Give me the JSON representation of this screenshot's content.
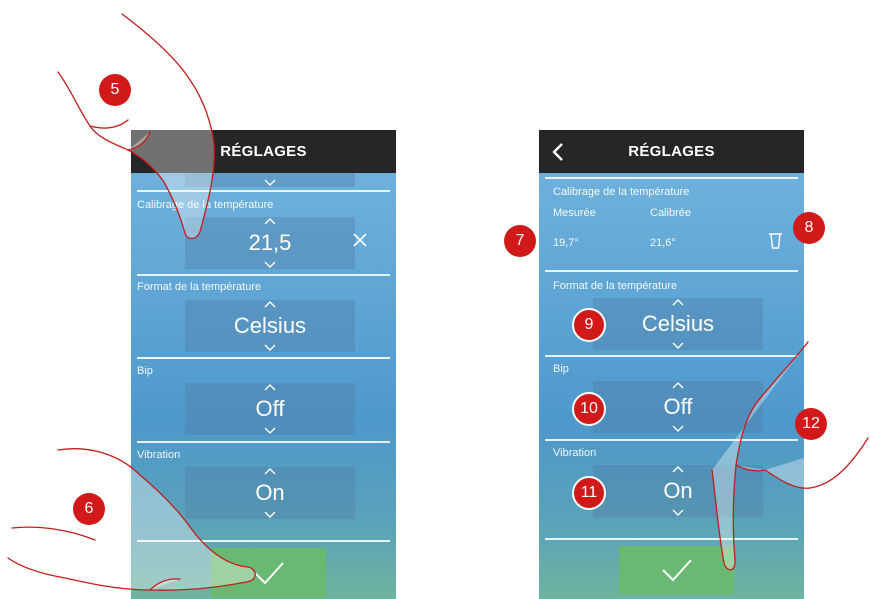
{
  "left_screen": {
    "title": "RÉGLAGES",
    "calibration": {
      "label": "Calibrage de la température",
      "value": "21,5",
      "clear_icon": "close-icon"
    },
    "format": {
      "label": "Format de la température",
      "value": "Celsius"
    },
    "bip": {
      "label": "Bip",
      "value": "Off"
    },
    "vibration": {
      "label": "Vibration",
      "value": "On"
    },
    "confirm_icon": "check-icon"
  },
  "right_screen": {
    "title": "RÉGLAGES",
    "back_icon": "chevron-left-icon",
    "calibration": {
      "label": "Calibrage de la température",
      "measured_label": "Mesurée",
      "calibrated_label": "Calibrée",
      "measured_value": "19,7°",
      "calibrated_value": "21,6°",
      "delete_icon": "trash-icon"
    },
    "format": {
      "label": "Format de la température",
      "value": "Celsius"
    },
    "bip": {
      "label": "Bip",
      "value": "Off"
    },
    "vibration": {
      "label": "Vibration",
      "value": "On"
    },
    "confirm_icon": "check-icon"
  },
  "callouts": [
    "5",
    "6",
    "7",
    "8",
    "9",
    "10",
    "11",
    "12"
  ],
  "colors": {
    "topbar": "#262626",
    "confirm": "#6ab973",
    "badge": "#d1191a",
    "hand_outline": "#c41c1c"
  }
}
